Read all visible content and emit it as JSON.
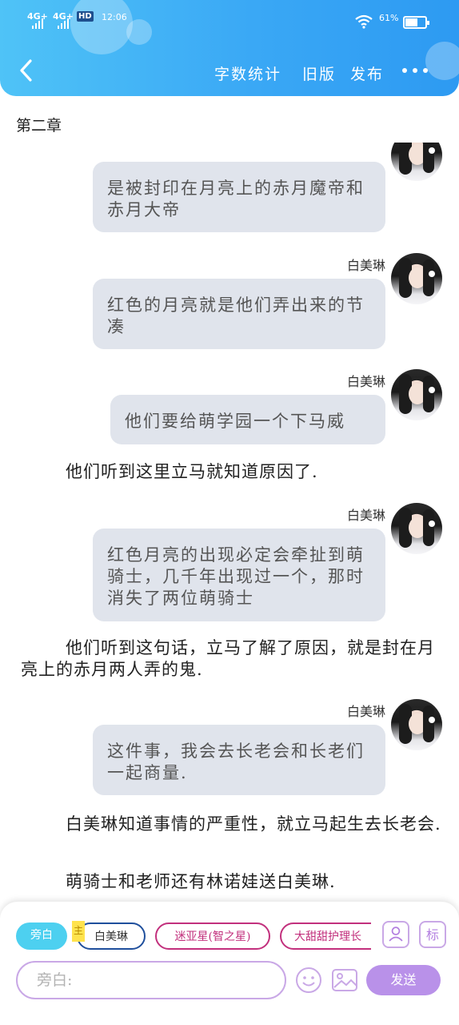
{
  "status_bar": {
    "signal1": "4G+",
    "signal2": "4G+",
    "hd": "HD",
    "time": "12:06",
    "battery_text": "61%",
    "battery_level": 0.61
  },
  "header": {
    "back_icon": "chevron-left-icon",
    "word_count": "字数统计",
    "old_version": "旧版",
    "publish": "发布",
    "more_icon": "more-dots-icon"
  },
  "chapter_title": "第二章",
  "content": {
    "bubble0_text": "是被封印在月亮上的赤月魔帝和赤月大帝",
    "dialog1": {
      "speaker": "白美琳",
      "text": "红色的月亮就是他们弄出来的节凑"
    },
    "dialog2": {
      "speaker": "白美琳",
      "text": "他们要给萌学园一个下马威"
    },
    "narration1": "他们听到这里立马就知道原因了.",
    "dialog3": {
      "speaker": "白美琳",
      "text": "红色月亮的出现必定会牵扯到萌骑士，几千年出现过一个，那时消失了两位萌骑士"
    },
    "narration2": "他们听到这句话，立马了解了原因，就是封在月亮上的赤月两人弄的鬼.",
    "dialog4": {
      "speaker": "白美琳",
      "text": "这件事，我会去长老会和长老们一起商量."
    },
    "narration3": "白美琳知道事情的严重性，就立马起生去长老会.",
    "narration4": "萌骑士和老师还有林诺娃送白美琳."
  },
  "bottom_bar": {
    "tags": [
      "旁白",
      "白美琳",
      "迷亚星(智之星)",
      "大甜甜护理长"
    ],
    "main_marker": "主",
    "input_placeholder": "旁白:",
    "send_label": "发送",
    "icons": [
      "character-icon",
      "tag-icon",
      "emoji-icon",
      "image-icon"
    ],
    "accent_color": "#b991e9"
  }
}
